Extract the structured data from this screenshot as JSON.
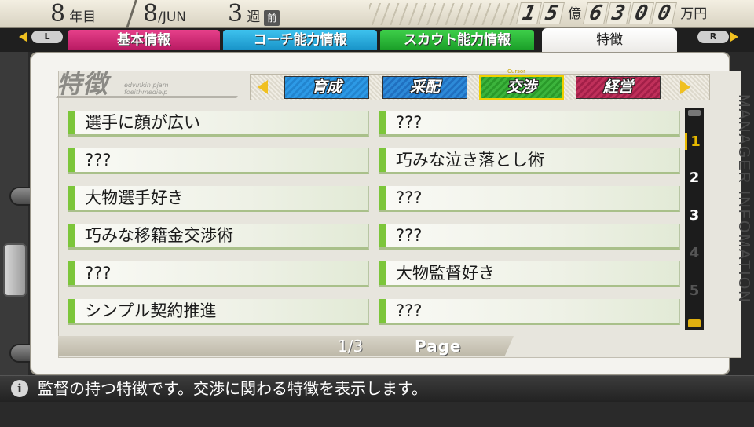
{
  "status": {
    "year": "8",
    "year_unit": "年目",
    "day": "8",
    "month": "/JUN",
    "week": "3",
    "week_unit": "週",
    "week_badge": "前",
    "money_digits": [
      "1",
      "5"
    ],
    "money_oku": "億",
    "money_digits2": [
      "6",
      "3",
      "0",
      "0"
    ],
    "money_unit": "万円"
  },
  "tabs": {
    "l_button": "L",
    "r_button": "R",
    "basic": "基本情報",
    "coach": "コーチ能力情報",
    "scout": "スカウト能力情報",
    "features": "特徴"
  },
  "section": {
    "title": "特徴",
    "subtitle_line1": "edvinkin pjam",
    "subtitle_line2": "foeithmedieip"
  },
  "categories": {
    "cursor_label": "Cursor",
    "ikusei": "育成",
    "saihai": "采配",
    "kosho": "交渉",
    "keiei": "経営"
  },
  "items_left": [
    "選手に顔が広い",
    "???",
    "大物選手好き",
    "巧みな移籍金交渉術",
    "???",
    "シンプル契約推進"
  ],
  "items_right": [
    "???",
    "巧みな泣き落とし術",
    "???",
    "???",
    "大物監督好き",
    "???"
  ],
  "pager": {
    "current": "1/3",
    "label": "Page",
    "pages": [
      "1",
      "2",
      "3",
      "4",
      "5"
    ]
  },
  "side_label": "MANAGER INFOMATION",
  "message": {
    "icon": "i",
    "text": "監督の持つ特徴です。交渉に関わる特徴を表示します。"
  }
}
